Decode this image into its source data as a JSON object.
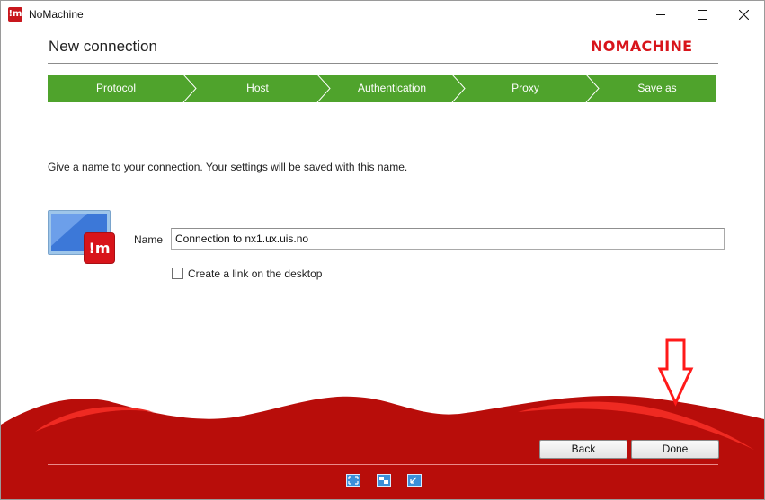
{
  "window": {
    "title": "NoMachine"
  },
  "header": {
    "title": "New connection",
    "brand": "NOMACHINE"
  },
  "steps": [
    "Protocol",
    "Host",
    "Authentication",
    "Proxy",
    "Save as"
  ],
  "main": {
    "instruction": "Give a name to your connection. Your settings will be saved with this name.",
    "name_label": "Name",
    "name_value": "Connection to nx1.ux.uis.no",
    "desktop_link_label": "Create a link on the desktop",
    "desktop_link_checked": false
  },
  "footer": {
    "back_label": "Back",
    "done_label": "Done"
  },
  "icons": {
    "app": "nomachine-app-icon",
    "connection": "monitor-connection-icon",
    "annotation": "red-down-arrow-icon",
    "bottom": [
      "fullscreen-icon",
      "display-settings-icon",
      "window-icon"
    ]
  },
  "colors": {
    "accent": "#d8141a",
    "steps": "#4fa32c",
    "footer": "#b80d0a"
  }
}
